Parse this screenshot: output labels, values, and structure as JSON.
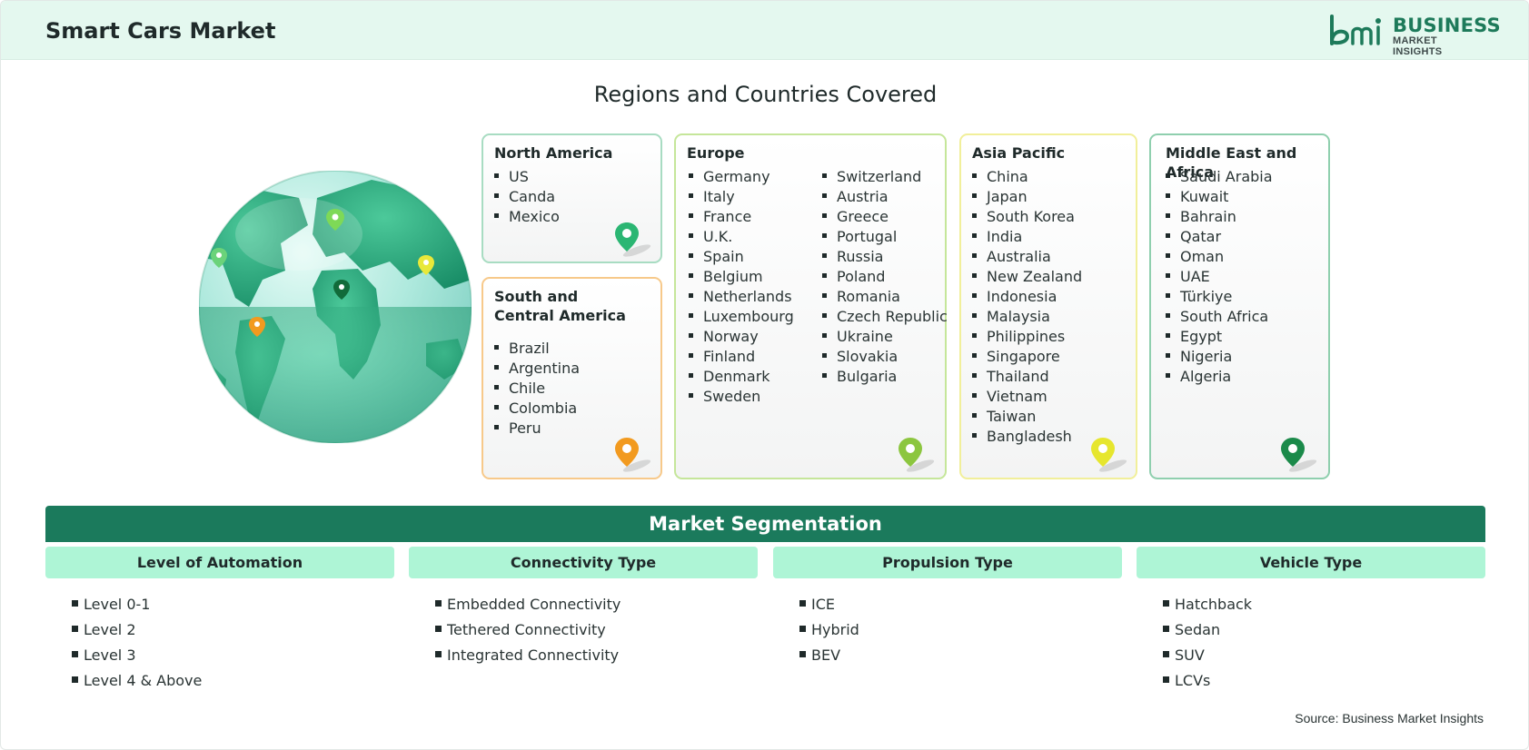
{
  "header": {
    "title": "Smart Cars Market",
    "logo": {
      "line1": "BUSINESS",
      "line2": "MARKET INSIGHTS",
      "brand_color": "#1d7a5a"
    }
  },
  "regions_title": "Regions and Countries Covered",
  "regions": {
    "north_america": {
      "name": "North America",
      "border": "#a8dcc2",
      "pin_color": "#2bb673",
      "countries": [
        "US",
        "Canda",
        "Mexico"
      ]
    },
    "south_america": {
      "name_line1": "South and",
      "name_line2": "Central America",
      "border": "#f7c98a",
      "pin_color": "#f29a1f",
      "countries": [
        "Brazil",
        "Argentina",
        "Chile",
        "Colombia",
        "Peru"
      ]
    },
    "europe": {
      "name": "Europe",
      "border": "#c5e69a",
      "pin_color": "#8cc63f",
      "countries_col1": [
        "Germany",
        "Italy",
        "France",
        "U.K.",
        "Spain",
        "Belgium",
        "Netherlands",
        "Luxembourg",
        "Norway",
        "Finland",
        "Denmark",
        "Sweden"
      ],
      "countries_col2": [
        "Switzerland",
        "Austria",
        "Greece",
        "Portugal",
        "Russia",
        "Poland",
        "Romania",
        "Czech Republic",
        "Ukraine",
        "Slovakia",
        "Bulgaria"
      ]
    },
    "asia_pacific": {
      "name": "Asia Pacific",
      "border": "#f1ef9a",
      "pin_color": "#e6e62e",
      "countries": [
        "China",
        "Japan",
        "South Korea",
        "India",
        "Australia",
        "New Zealand",
        "Indonesia",
        "Malaysia",
        "Philippines",
        "Singapore",
        "Thailand",
        "Vietnam",
        "Taiwan",
        "Bangladesh"
      ]
    },
    "mea": {
      "name": "Middle East and Africa",
      "border": "#8fcfae",
      "pin_color": "#1b8a4a",
      "countries": [
        "Saudi Arabia",
        "Kuwait",
        "Bahrain",
        "Qatar",
        "Oman",
        "UAE",
        "Türkiye",
        "South Africa",
        "Egypt",
        "Nigeria",
        "Algeria"
      ]
    }
  },
  "segmentation": {
    "title": "Market Segmentation",
    "columns": [
      {
        "title": "Level of Automation",
        "items": [
          "Level 0-1",
          "Level 2",
          "Level 3",
          "Level 4 & Above"
        ]
      },
      {
        "title": "Connectivity Type",
        "items": [
          "Embedded Connectivity",
          "Tethered Connectivity",
          "Integrated Connectivity"
        ]
      },
      {
        "title": "Propulsion Type",
        "items": [
          "ICE",
          "Hybrid",
          "BEV"
        ]
      },
      {
        "title": "Vehicle Type",
        "items": [
          "Hatchback",
          "Sedan",
          "SUV",
          "LCVs"
        ]
      }
    ]
  },
  "source": "Source: Business Market Insights"
}
